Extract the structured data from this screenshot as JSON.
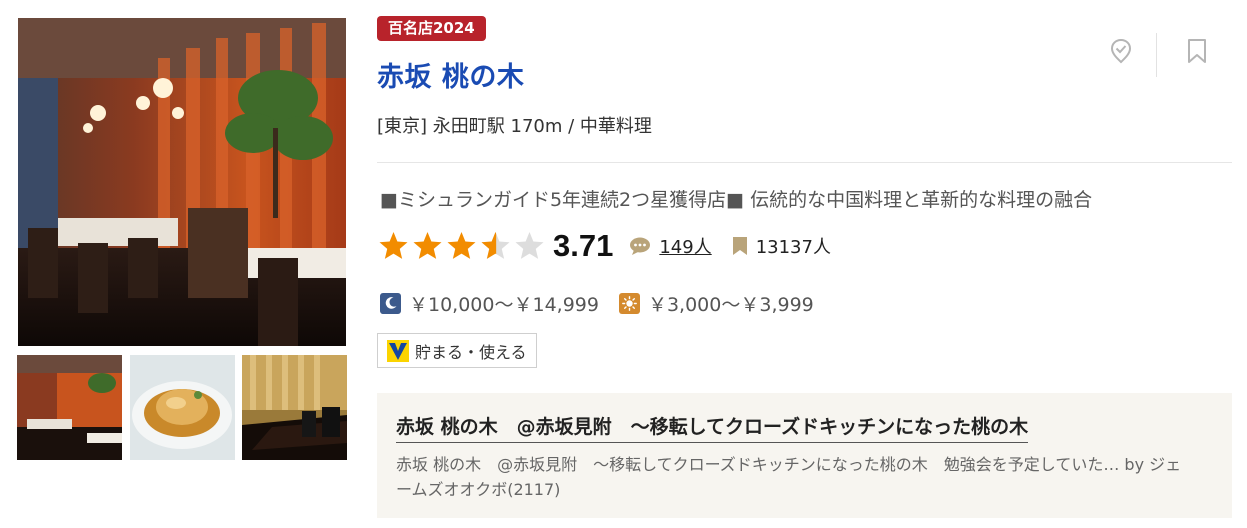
{
  "badge": "百名店2024",
  "restaurant": {
    "name": "赤坂 桃の木",
    "area": "[東京] 永田町駅 170m / 中華料理",
    "pr": "■ミシュランガイド5年連続2つ星獲得店■ 伝統的な中国料理と革新的な料理の融合"
  },
  "rating": {
    "score": "3.71",
    "stars_value": 3.5,
    "stars_max": 5,
    "reviews": "149人",
    "bookmarks": "13137人"
  },
  "budget": {
    "dinner": "￥10,000～￥14,999",
    "lunch": "￥3,000～￥3,999"
  },
  "tpoint": "貯まる・使える",
  "review": {
    "title": "赤坂 桃の木　@赤坂見附　～移転してクローズドキッチンになった桃の木",
    "excerpt": "赤坂 桃の木　@赤坂見附　～移転してクローズドキッチンになった桃の木　勉強会を予定していた…",
    "author": "by ジェームズオオクボ(2117)"
  },
  "icons": {
    "visited": "visited-check-icon",
    "save": "bookmark-icon",
    "review": "speech-bubble-icon",
    "bookmark_count": "bookmark-icon",
    "dinner": "moon-icon",
    "lunch": "sun-icon",
    "tpoint": "v-point-logo"
  },
  "colors": {
    "badge": "#b8232b",
    "title_link": "#1a4bb3",
    "star": "#f28c00",
    "star_empty": "#dddddd",
    "review_bg": "#f7f5f0"
  }
}
